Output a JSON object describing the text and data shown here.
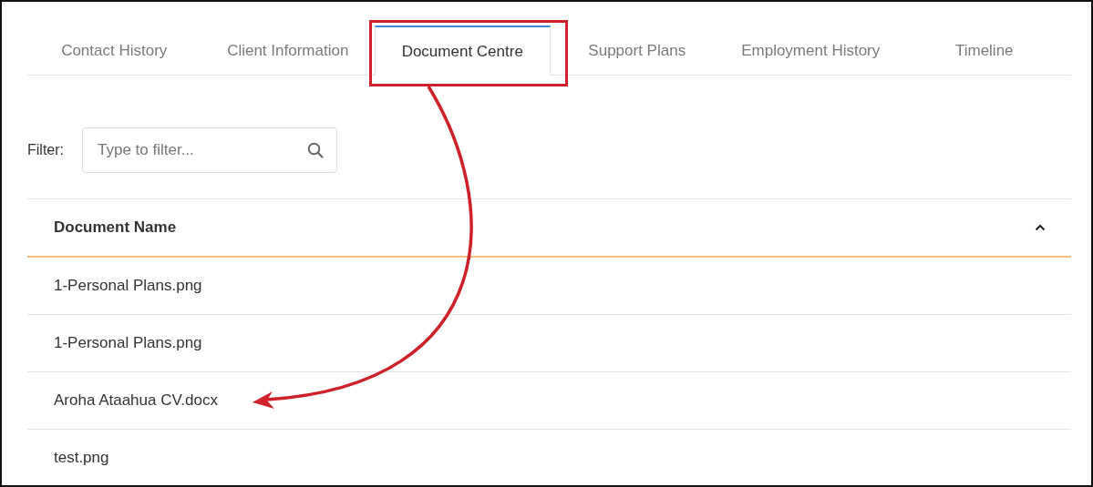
{
  "tabs": [
    {
      "label": "Contact History",
      "selected": false,
      "highlighted": false
    },
    {
      "label": "Client Information",
      "selected": false,
      "highlighted": false
    },
    {
      "label": "Document Centre",
      "selected": true,
      "highlighted": true
    },
    {
      "label": "Support Plans",
      "selected": false,
      "highlighted": false
    },
    {
      "label": "Employment History",
      "selected": false,
      "highlighted": false
    },
    {
      "label": "Timeline",
      "selected": false,
      "highlighted": false
    }
  ],
  "filter": {
    "label": "Filter:",
    "placeholder": "Type to filter..."
  },
  "table": {
    "columns": [
      {
        "label": "Document Name",
        "sorted_ascending": true
      }
    ],
    "rows": [
      {
        "name": "1-Personal Plans.png",
        "pointed": false
      },
      {
        "name": "1-Personal Plans.png",
        "pointed": false
      },
      {
        "name": "Aroha Ataahua CV.docx",
        "pointed": true
      },
      {
        "name": "test.png",
        "pointed": false
      }
    ]
  }
}
